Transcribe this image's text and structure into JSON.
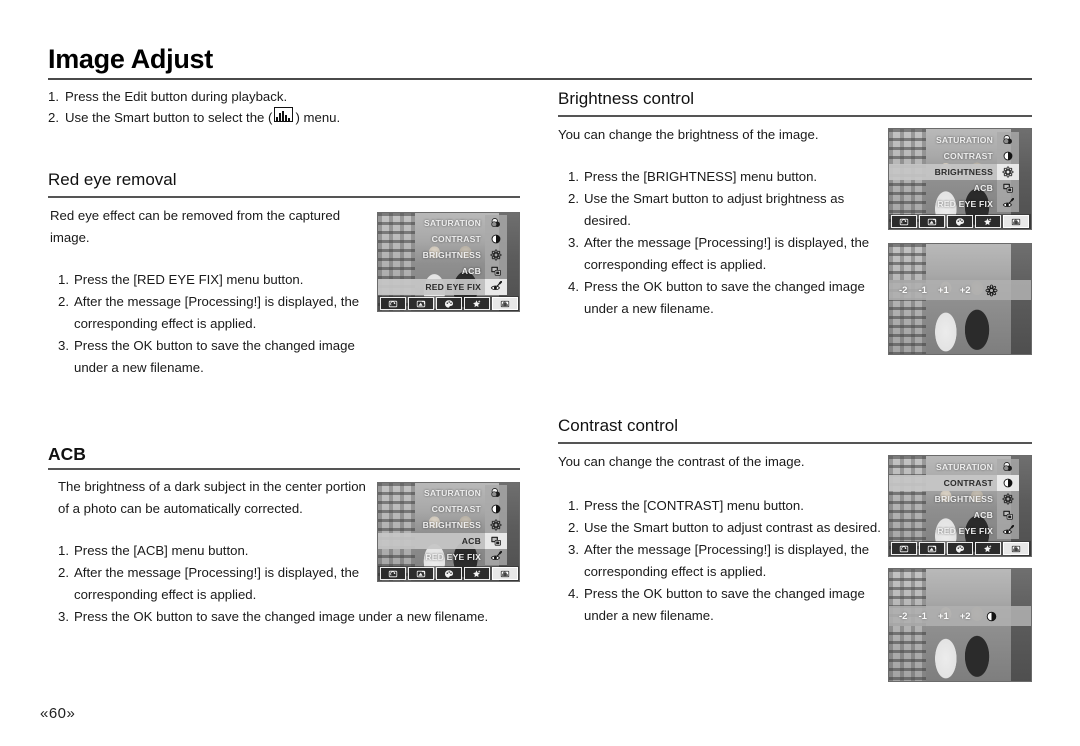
{
  "page": {
    "title": "Image Adjust",
    "page_number": "«60»"
  },
  "intro": {
    "steps": [
      {
        "num": "1.",
        "text_before": "Press the Edit button during playback.",
        "icon": null,
        "text_after": ""
      },
      {
        "num": "2.",
        "text_before": "Use the Smart button to select the ( ",
        "icon": "histogram-icon",
        "text_after": " ) menu."
      }
    ]
  },
  "sections": {
    "red_eye": {
      "heading": "Red eye removal",
      "intro": "Red eye effect can be removed from the captured image.",
      "steps": [
        {
          "num": "1.",
          "text": "Press the [RED EYE FIX] menu button."
        },
        {
          "num": "2.",
          "text": "After the message [Processing!] is displayed, the corresponding effect is applied."
        },
        {
          "num": "3.",
          "text": "Press the OK button to save the changed image under a new filename."
        }
      ]
    },
    "acb": {
      "heading": "ACB",
      "intro": "The brightness of a dark subject in the center portion of a photo can be automatically corrected.",
      "steps": [
        {
          "num": "1.",
          "text": "Press the [ACB] menu button."
        },
        {
          "num": "2.",
          "text": "After the message [Processing!] is displayed, the corresponding effect is applied."
        },
        {
          "num": "3.",
          "text": "Press the OK button to save the changed image under a new filename."
        }
      ]
    },
    "brightness": {
      "heading": "Brightness control",
      "intro": "You can change the brightness of the image.",
      "steps": [
        {
          "num": "1.",
          "text": "Press the [BRIGHTNESS] menu button."
        },
        {
          "num": "2.",
          "text": "Use the Smart button to adjust brightness as desired."
        },
        {
          "num": "3.",
          "text": "After the message [Processing!] is displayed, the corresponding effect is applied."
        },
        {
          "num": "4.",
          "text": "Press the OK button to save the changed image under a new filename."
        }
      ]
    },
    "contrast": {
      "heading": "Contrast control",
      "intro": "You can change the contrast of the image.",
      "steps": [
        {
          "num": "1.",
          "text": "Press the [CONTRAST] menu button."
        },
        {
          "num": "2.",
          "text": "Use the Smart button to adjust contrast as desired."
        },
        {
          "num": "3.",
          "text": "After the message [Processing!] is displayed, the corresponding effect is applied."
        },
        {
          "num": "4.",
          "text": "Press the OK button to save the changed image under a new filename."
        }
      ]
    }
  },
  "camera_screens": {
    "menu_labels": [
      "SATURATION",
      "CONTRAST",
      "BRIGHTNESS",
      "ACB",
      "RED EYE FIX"
    ],
    "menu_icons": [
      "saturation-icon",
      "contrast-icon",
      "brightness-icon",
      "acb-icon",
      "red-eye-fix-icon"
    ],
    "tab_icons": [
      "rotate-icon",
      "resize-icon",
      "palette-icon",
      "effect-icon",
      "image-adjust-icon"
    ],
    "selected_tab_index": 4,
    "adjust_values": [
      "-2",
      "-1",
      "+1",
      "+2"
    ],
    "screens": [
      {
        "id": "red-eye-screen",
        "selected_row": 4
      },
      {
        "id": "acb-screen",
        "selected_row": 3
      },
      {
        "id": "brightness-menu-screen",
        "selected_row": 2
      },
      {
        "id": "brightness-adjust-screen",
        "adjust_icon": "brightness-icon"
      },
      {
        "id": "contrast-menu-screen",
        "selected_row": 1
      },
      {
        "id": "contrast-adjust-screen",
        "adjust_icon": "contrast-icon"
      }
    ]
  },
  "colors": {
    "rule": "#4a4a4a",
    "text": "#1a1a1a",
    "lcd_highlight": "#c6c6c6"
  }
}
